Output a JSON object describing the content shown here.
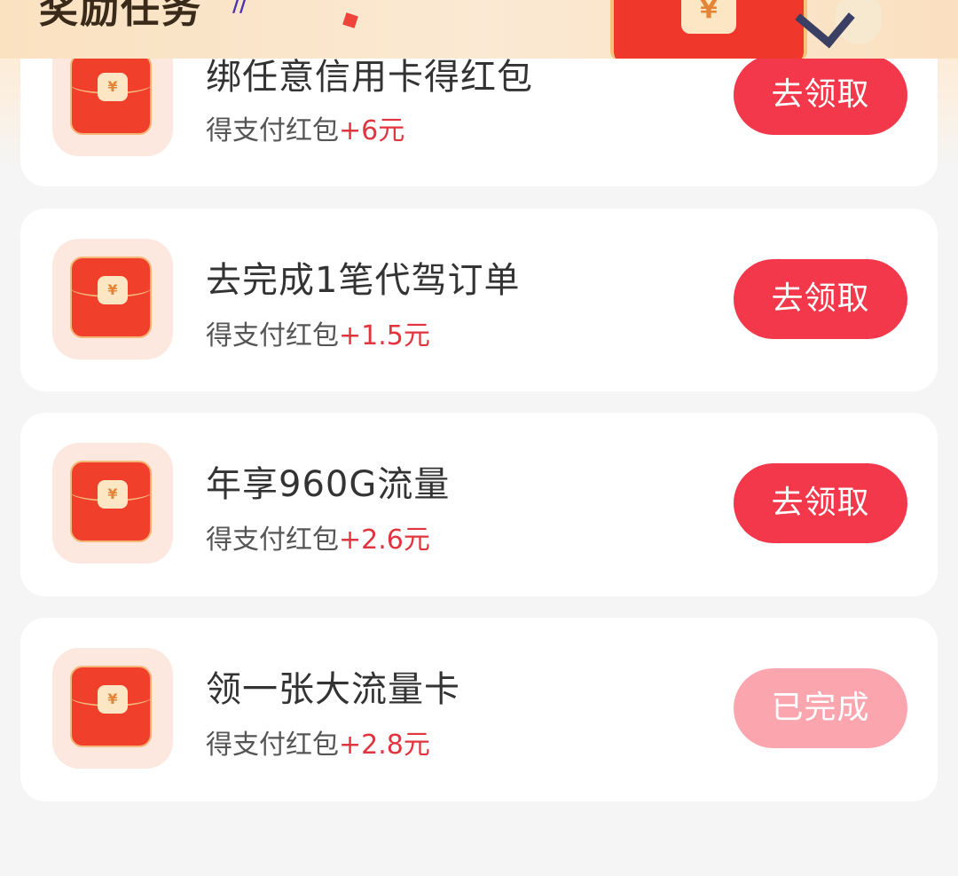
{
  "header": {
    "title": "奖励任务",
    "envelope_symbol": "¥"
  },
  "tasks": [
    {
      "title": "绑任意信用卡得红包",
      "reward_prefix": "得支付红包",
      "reward_amount": "+6元",
      "button_label": "去领取",
      "status": "pending",
      "icon": "red-envelope-icon",
      "envelope_symbol": "¥"
    },
    {
      "title": "去完成1笔代驾订单",
      "reward_prefix": "得支付红包",
      "reward_amount": "+1.5元",
      "button_label": "去领取",
      "status": "pending",
      "icon": "red-envelope-icon",
      "envelope_symbol": "¥"
    },
    {
      "title": "年享960G流量",
      "reward_prefix": "得支付红包",
      "reward_amount": "+2.6元",
      "button_label": "去领取",
      "status": "pending",
      "icon": "red-envelope-icon",
      "envelope_symbol": "¥"
    },
    {
      "title": "领一张大流量卡",
      "reward_prefix": "得支付红包",
      "reward_amount": "+2.8元",
      "button_label": "已完成",
      "status": "completed",
      "icon": "red-envelope-icon",
      "envelope_symbol": "¥"
    }
  ],
  "colors": {
    "accent": "#f2384a",
    "completed_button": "#fba5ae",
    "reward_text": "#e2343e"
  }
}
